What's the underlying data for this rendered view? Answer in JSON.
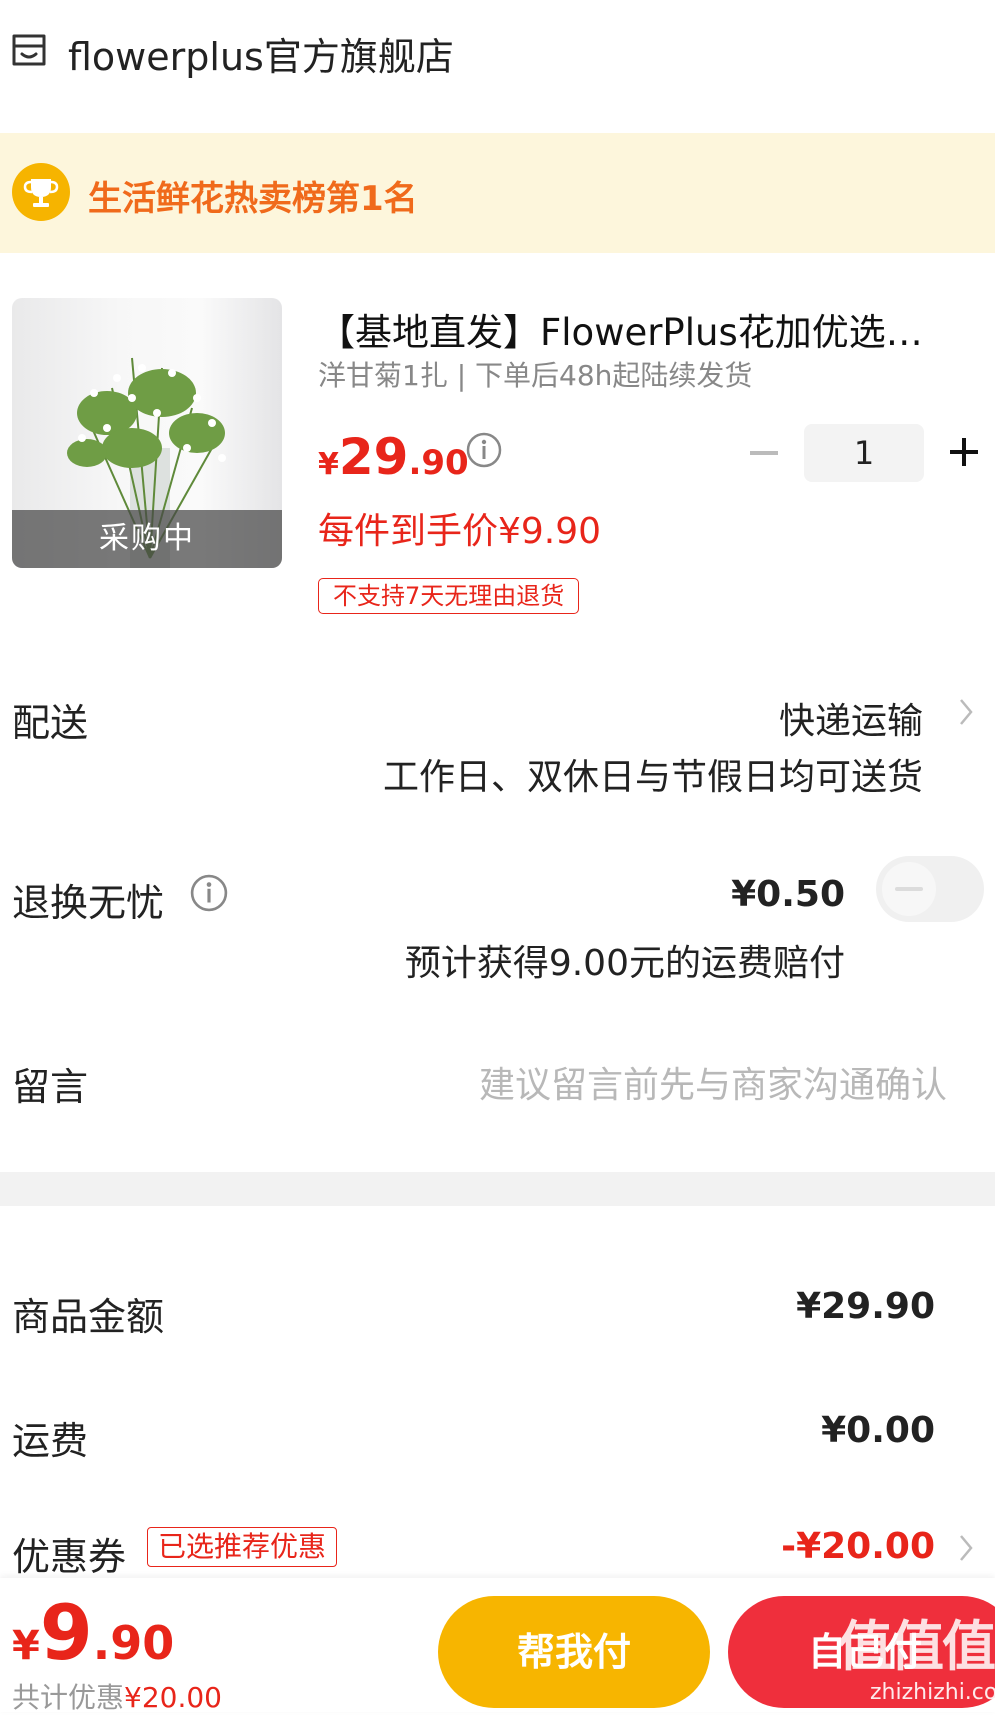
{
  "store": {
    "name": "flowerplus官方旗舰店",
    "icon": "store-icon"
  },
  "ranking": {
    "text": "生活鲜花热卖榜第1名",
    "icon": "trophy-icon"
  },
  "product": {
    "image_badge": "采购中",
    "title": "【基地直发】FlowerPlus花加优选…",
    "spec": "洋甘菊1扎 | 下单后48h起陆续发货",
    "price_currency": "¥",
    "price_integer": "29",
    "price_decimal": ".90",
    "quantity": "1",
    "unit_price": "每件到手价¥9.90",
    "return_tag": "不支持7天无理由退货"
  },
  "delivery": {
    "label": "配送",
    "method": "快递运输",
    "note": "工作日、双休日与节假日均可送货"
  },
  "return_insurance": {
    "label": "退换无忧",
    "price": "¥0.50",
    "note": "预计获得9.00元的运费赔付",
    "enabled": false
  },
  "message": {
    "label": "留言",
    "placeholder": "建议留言前先与商家沟通确认"
  },
  "summary": {
    "goods_label": "商品金额",
    "goods_value": "¥29.90",
    "shipping_label": "运费",
    "shipping_value": "¥0.00",
    "coupon_label": "优惠券",
    "coupon_tag": "已选推荐优惠",
    "coupon_value": "-¥20.00"
  },
  "footer": {
    "total_currency": "¥",
    "total_integer": "9",
    "total_decimal": ".90",
    "saved_prefix": "共计优惠",
    "saved_value": "¥20.00",
    "help_pay_label": "帮我付",
    "self_pay_label": "自己付",
    "watermark": "值值值",
    "watermark_sub": "zhizhizhi.com"
  },
  "colors": {
    "accent_red": "#e8251a",
    "rank_orange": "#f06a1b",
    "help_pay_yellow": "#f7b500",
    "self_pay_red": "#ef2f3c"
  }
}
